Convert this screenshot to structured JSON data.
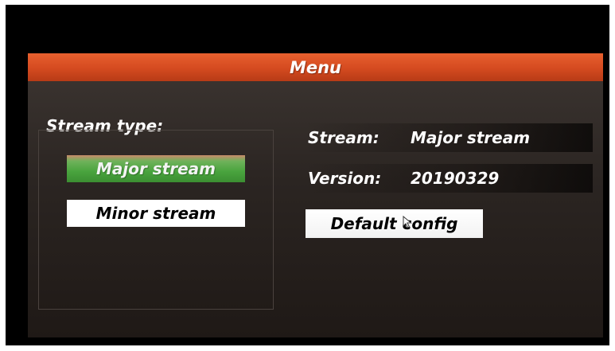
{
  "menu": {
    "title": "Menu"
  },
  "stream_type": {
    "label": "Stream type:",
    "options": [
      {
        "label": "Major stream",
        "selected": true
      },
      {
        "label": "Minor stream",
        "selected": false
      }
    ]
  },
  "info": {
    "stream_label": "Stream:",
    "stream_value": "Major stream",
    "version_label": "Version:",
    "version_value": "20190329"
  },
  "actions": {
    "default_config_label": "Default config"
  },
  "colors": {
    "header_accent": "#d44a20",
    "selected_option": "#49a43e",
    "panel_bg": "#2b2522"
  },
  "icons": {
    "pointer": "mouse-pointer-icon"
  }
}
